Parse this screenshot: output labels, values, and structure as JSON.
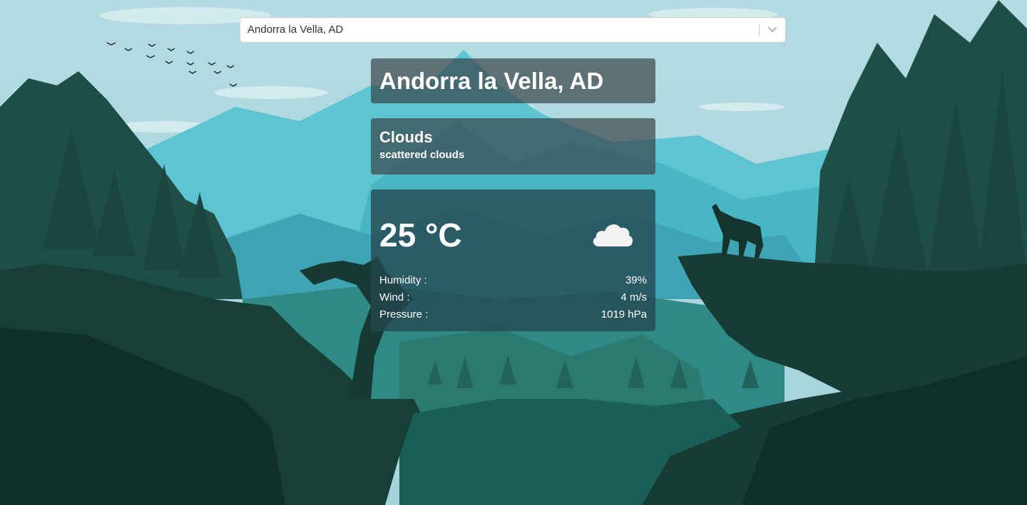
{
  "search": {
    "selected_value": "Andorra la Vella, AD",
    "chevron_icon": "chevron-down-icon"
  },
  "location": {
    "title": "Andorra la Vella, AD"
  },
  "condition": {
    "main": "Clouds",
    "description": "scattered clouds"
  },
  "weather": {
    "temperature": "25 °C",
    "icon": "cloud-icon",
    "details": [
      {
        "label": "Humidity :",
        "value": "39%"
      },
      {
        "label": "Wind :",
        "value": "4 m/s"
      },
      {
        "label": "Pressure :",
        "value": "1019 hPa"
      }
    ]
  },
  "colors": {
    "card_background": "#3c464c",
    "card_text": "#ffffff",
    "sky": "#a9d3dc",
    "forest": "#17382f"
  }
}
